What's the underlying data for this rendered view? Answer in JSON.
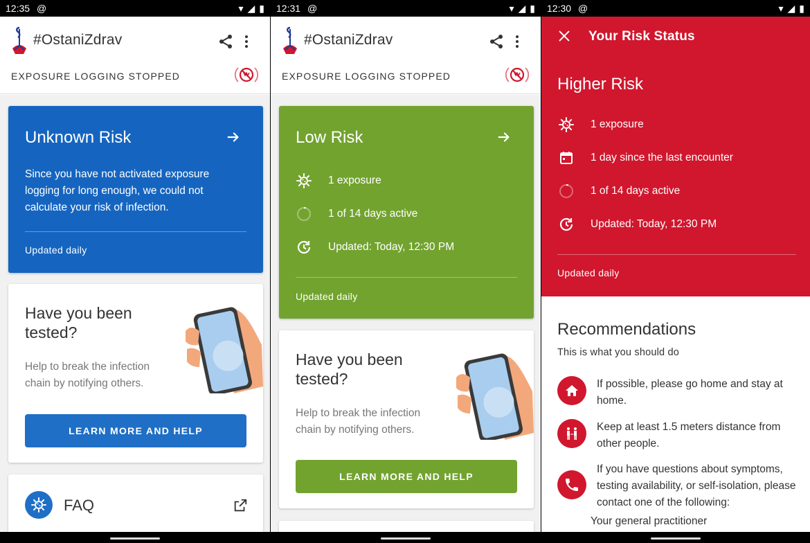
{
  "colors": {
    "blue": "#1565c0",
    "green": "#72a32f",
    "red": "#d0172e",
    "button_blue": "#1f6fc6",
    "button_green": "#72a32f"
  },
  "app": {
    "title": "#OstaniZdrav",
    "exposure_status": "EXPOSURE LOGGING STOPPED"
  },
  "screen1": {
    "time": "12:35",
    "risk_card": {
      "title": "Unknown Risk",
      "description": "Since you have not activated exposure logging for long enough, we could not calculate your risk of infection.",
      "updated": "Updated daily"
    },
    "tested_card": {
      "title": "Have you been tested?",
      "description": "Help to break the infection chain by notifying others.",
      "button": "LEARN MORE AND HELP"
    },
    "faq": {
      "label": "FAQ"
    }
  },
  "screen2": {
    "time": "12:31",
    "risk_card": {
      "title": "Low Risk",
      "rows": [
        {
          "icon": "virus-icon",
          "text": "1 exposure"
        },
        {
          "icon": "progress-circle-icon",
          "text": "1 of 14 days active"
        },
        {
          "icon": "update-clock-icon",
          "text": "Updated: Today, 12:30 PM"
        }
      ],
      "updated": "Updated daily"
    },
    "tested_card": {
      "title": "Have you been tested?",
      "description": "Help to break the infection chain by notifying others.",
      "button": "LEARN MORE AND HELP"
    }
  },
  "screen3": {
    "time": "12:30",
    "header_title": "Your Risk Status",
    "risk_title": "Higher Risk",
    "rows": [
      {
        "icon": "virus-icon",
        "text": "1 exposure"
      },
      {
        "icon": "calendar-icon",
        "text": "1 day since the last encounter"
      },
      {
        "icon": "progress-circle-icon",
        "text": "1 of 14 days active"
      },
      {
        "icon": "update-clock-icon",
        "text": "Updated: Today, 12:30 PM"
      }
    ],
    "updated": "Updated daily",
    "recommendations": {
      "title": "Recommendations",
      "subtitle": "This is what you should do",
      "items": [
        {
          "icon": "home-icon",
          "text": "If possible, please go home and stay at home."
        },
        {
          "icon": "people-distance-icon",
          "text": "Keep at least 1.5 meters distance from other people."
        },
        {
          "icon": "phone-icon",
          "text": "If you have questions about symptoms, testing availability, or self-isolation, please contact one of the following:"
        }
      ],
      "contact": "Your general practitioner"
    }
  }
}
